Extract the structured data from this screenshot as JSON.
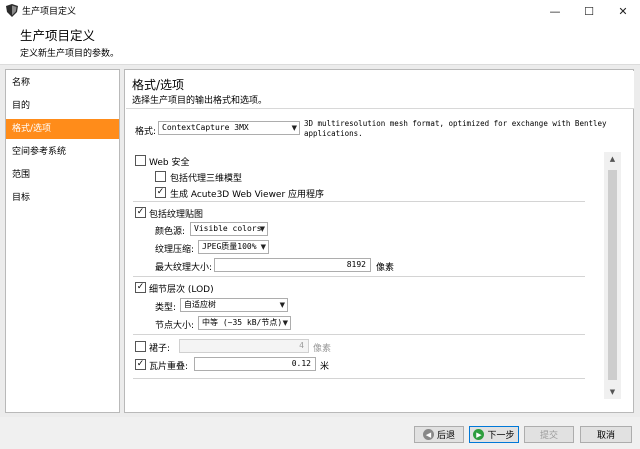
{
  "window": {
    "title": "生产项目定义",
    "controls": {
      "minimize": "—",
      "maximize": "☐",
      "close": "✕"
    }
  },
  "header": {
    "title": "生产项目定义",
    "subtitle": "定义新生产项目的参数。"
  },
  "sidebar": {
    "items": [
      {
        "label": "名称"
      },
      {
        "label": "目的"
      },
      {
        "label": "格式/选项"
      },
      {
        "label": "空间参考系统"
      },
      {
        "label": "范围"
      },
      {
        "label": "目标"
      }
    ],
    "active_index": 2,
    "active_color": "#ff8c1a"
  },
  "panel": {
    "title": "格式/选项",
    "subtitle": "选择生产项目的输出格式和选项。",
    "format": {
      "label": "格式:",
      "value": "ContextCapture 3MX",
      "description": "3D multiresolution mesh format, optimized for exchange with Bentley applications."
    },
    "web_security": {
      "label": "Web 安全",
      "checked": false,
      "include_proxy": {
        "label": "包括代理三维模型",
        "checked": false
      },
      "generate_viewer": {
        "label": "生成 Acute3D Web Viewer 应用程序",
        "checked": true
      }
    },
    "texture": {
      "label": "包括纹理贴图",
      "checked": true,
      "color_source_label": "颜色源:",
      "color_source_value": "Visible colors",
      "compression_label": "纹理压缩:",
      "compression_value": "JPEG质量100%",
      "max_size_label": "最大纹理大小:",
      "max_size_value": "8192",
      "max_size_unit": "像素"
    },
    "lod": {
      "label": "细节层次 (LOD)",
      "checked": true,
      "type_label": "类型:",
      "type_value": "自适应树",
      "node_size_label": "节点大小:",
      "node_size_value": "中等 (~35 kB/节点)"
    },
    "skirt": {
      "label": "裙子:",
      "checked": false,
      "value": "4",
      "unit": "像素"
    },
    "tile_overlap": {
      "label": "瓦片重叠:",
      "checked": true,
      "value": "0.12",
      "unit": "米"
    }
  },
  "footer": {
    "back": "后退",
    "next": "下一步",
    "submit": "提交",
    "cancel": "取消"
  }
}
